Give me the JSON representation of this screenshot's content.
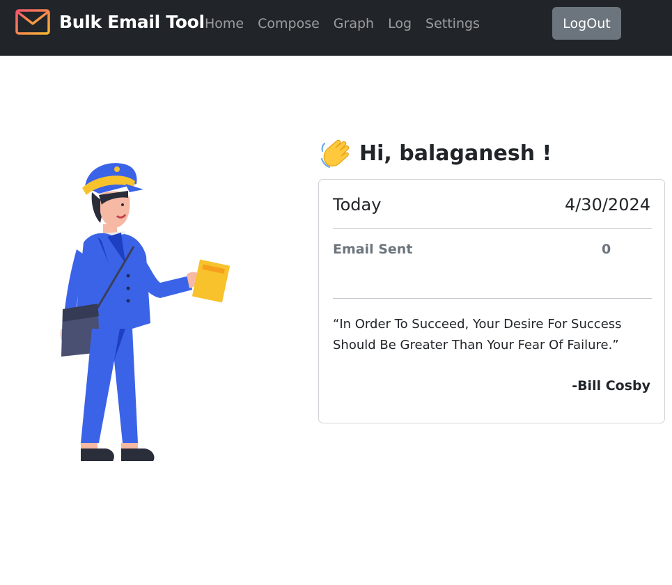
{
  "navbar": {
    "brand": "Bulk Email Tool",
    "brand_icon": "envelope-icon",
    "links": [
      "Home",
      "Compose",
      "Graph",
      "Log",
      "Settings"
    ],
    "logout_label": "LogOut"
  },
  "illustration": {
    "icon": "postman-illustration"
  },
  "greeting": {
    "icon": "waving-hand-icon",
    "text": "Hi, balaganesh !"
  },
  "summary": {
    "today_label": "Today",
    "date": "4/30/2024",
    "email_sent_label": "Email Sent",
    "email_sent_count": "0"
  },
  "quote": {
    "text": "“In Order To Succeed, Your Desire For Success Should Be Greater Than Your Fear Of Failure.”",
    "author": "-Bill Cosby"
  },
  "colors": {
    "navbar_bg": "#212529",
    "logo_gradient_start": "#f5576c",
    "logo_gradient_end": "#f7b733",
    "uniform_blue": "#3b63e8",
    "logout_bg": "#6c757d"
  }
}
